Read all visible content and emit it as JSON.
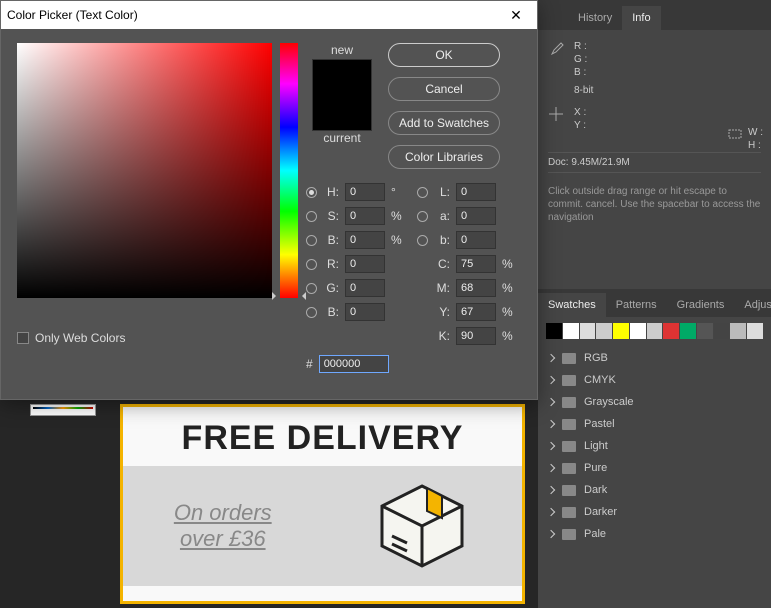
{
  "dialog": {
    "title": "Color Picker (Text Color)",
    "preview": {
      "new_label": "new",
      "current_label": "current"
    },
    "buttons": {
      "ok": "OK",
      "cancel": "Cancel",
      "add_swatches": "Add to Swatches",
      "color_libraries": "Color Libraries"
    },
    "fields": {
      "H": {
        "label": "H:",
        "value": "0",
        "unit": "°"
      },
      "S": {
        "label": "S:",
        "value": "0",
        "unit": "%"
      },
      "Bhsb": {
        "label": "B:",
        "value": "0",
        "unit": "%"
      },
      "R": {
        "label": "R:",
        "value": "0"
      },
      "G": {
        "label": "G:",
        "value": "0"
      },
      "Brgb": {
        "label": "B:",
        "value": "0"
      },
      "L": {
        "label": "L:",
        "value": "0"
      },
      "a": {
        "label": "a:",
        "value": "0"
      },
      "b": {
        "label": "b:",
        "value": "0"
      },
      "C": {
        "label": "C:",
        "value": "75",
        "unit": "%"
      },
      "M": {
        "label": "M:",
        "value": "68",
        "unit": "%"
      },
      "Y": {
        "label": "Y:",
        "value": "67",
        "unit": "%"
      },
      "K": {
        "label": "K:",
        "value": "90",
        "unit": "%"
      },
      "hex": {
        "label": "#",
        "value": "000000"
      }
    },
    "web_only": "Only Web Colors"
  },
  "right": {
    "top_tabs": {
      "history": "History",
      "info": "Info"
    },
    "info": {
      "R": "R :",
      "G": "G :",
      "B": "B :",
      "bit": "8-bit",
      "X": "X :",
      "Y": "Y :",
      "W": "W :",
      "H": "H :",
      "doc": "Doc: 9.45M/21.9M",
      "hint": "Click outside drag range or hit escape to commit. cancel. Use the spacebar to access the navigation"
    },
    "mid_tabs": {
      "swatches": "Swatches",
      "patterns": "Patterns",
      "gradients": "Gradients",
      "adjustments": "Adjustment"
    },
    "swatch_colors": [
      "#000",
      "#fff",
      "#ddd",
      "#ccc",
      "#ff0",
      "#fff",
      "#ccc",
      "#d33",
      "#0a6",
      "#555",
      "#444",
      "#bbb",
      "#ddd"
    ],
    "folders": [
      "RGB",
      "CMYK",
      "Grayscale",
      "Pastel",
      "Light",
      "Pure",
      "Dark",
      "Darker",
      "Pale"
    ]
  },
  "banner": {
    "title": "FREE DELIVERY",
    "line1": "On orders",
    "line2": "over £36"
  }
}
